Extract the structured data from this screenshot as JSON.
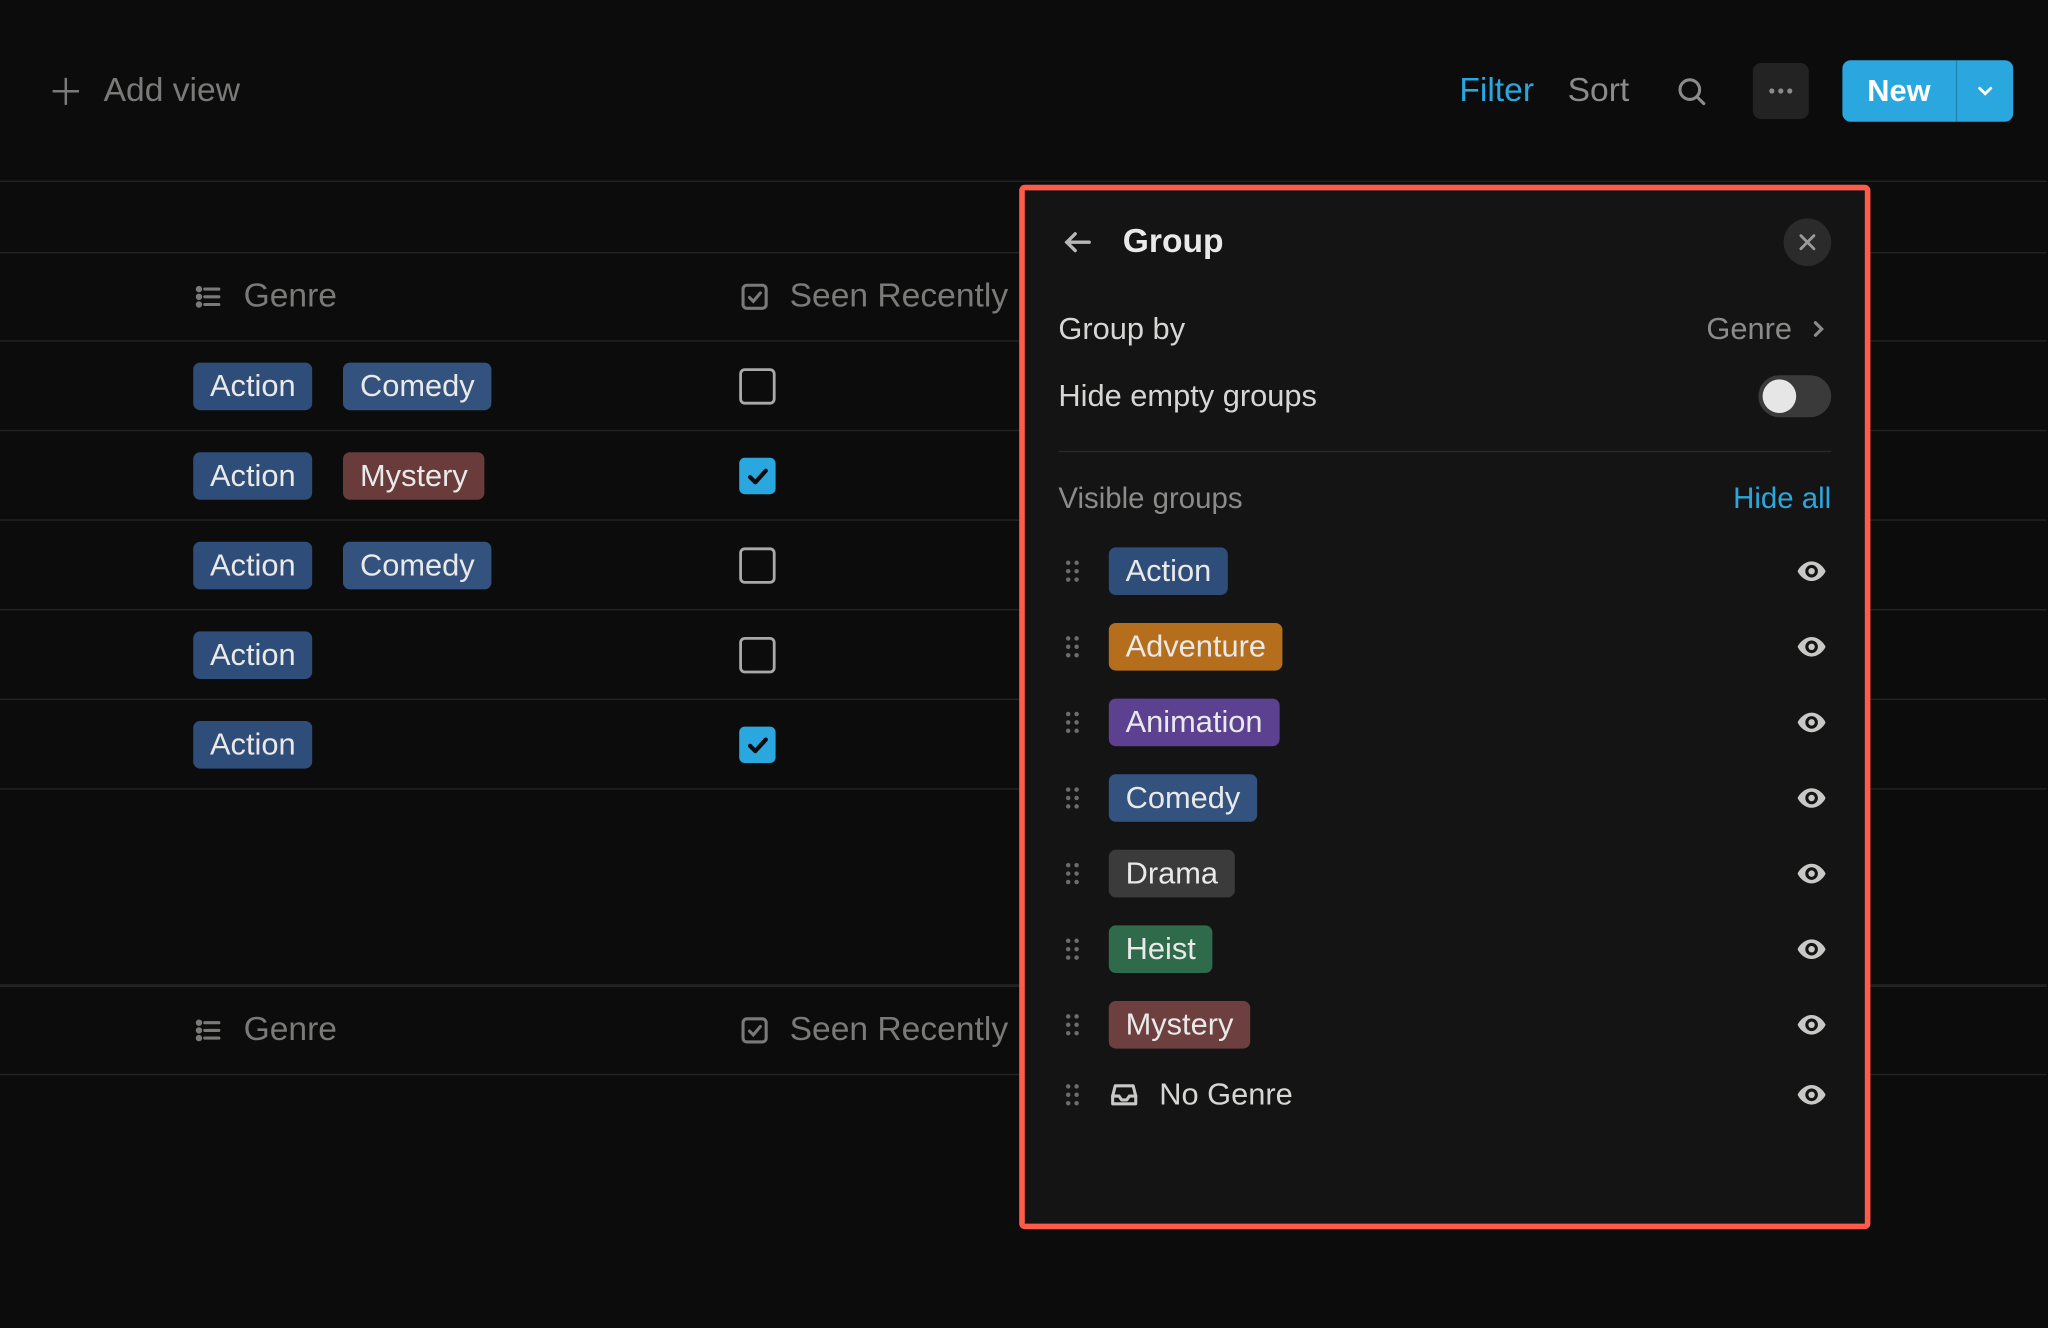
{
  "toolbar": {
    "add_view_label": "Add view",
    "filter_label": "Filter",
    "sort_label": "Sort",
    "new_label": "New"
  },
  "columns": {
    "genre_label": "Genre",
    "seen_label": "Seen Recently"
  },
  "tag_colors": {
    "Action": "tag-blue",
    "Comedy": "tag-bluec",
    "Mystery": "tag-red",
    "Adventure": "tag-orange",
    "Animation": "tag-purple",
    "Drama": "tag-grey",
    "Heist": "tag-green"
  },
  "rows": [
    {
      "genres": [
        "Action",
        "Comedy"
      ],
      "seen": false
    },
    {
      "genres": [
        "Action",
        "Mystery"
      ],
      "seen": true
    },
    {
      "genres": [
        "Action",
        "Comedy"
      ],
      "seen": false
    },
    {
      "genres": [
        "Action"
      ],
      "seen": false
    },
    {
      "genres": [
        "Action"
      ],
      "seen": true
    }
  ],
  "popover": {
    "title": "Group",
    "group_by_label": "Group by",
    "group_by_value": "Genre",
    "hide_empty_label": "Hide empty groups",
    "hide_empty_on": false,
    "visible_groups_label": "Visible groups",
    "hide_all_label": "Hide all",
    "no_genre_label": "No Genre",
    "groups": [
      {
        "name": "Action",
        "color": "tag-blue"
      },
      {
        "name": "Adventure",
        "color": "tag-orange"
      },
      {
        "name": "Animation",
        "color": "tag-purple"
      },
      {
        "name": "Comedy",
        "color": "tag-bluec"
      },
      {
        "name": "Drama",
        "color": "tag-grey"
      },
      {
        "name": "Heist",
        "color": "tag-green"
      },
      {
        "name": "Mystery",
        "color": "tag-brown"
      }
    ]
  }
}
